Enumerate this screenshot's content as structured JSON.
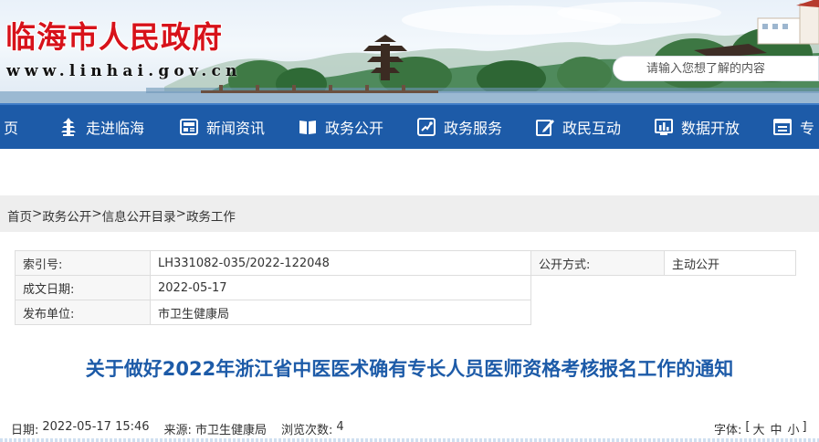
{
  "header": {
    "site_title": "临海市人民政府",
    "site_url": "www.linhai.gov.cn",
    "search_placeholder": "请输入您想了解的内容"
  },
  "nav": {
    "items": [
      {
        "label": "页",
        "icon": "home-icon"
      },
      {
        "label": "走进临海",
        "icon": "pagoda-icon"
      },
      {
        "label": "新闻资讯",
        "icon": "news-icon"
      },
      {
        "label": "政务公开",
        "icon": "book-icon"
      },
      {
        "label": "政务服务",
        "icon": "service-icon"
      },
      {
        "label": "政民互动",
        "icon": "edit-icon"
      },
      {
        "label": "数据开放",
        "icon": "chart-icon"
      },
      {
        "label": "专",
        "icon": "topic-icon"
      }
    ]
  },
  "breadcrumb": {
    "items": [
      "首页",
      "政务公开",
      "信息公开目录",
      "政务工作"
    ],
    "separator": ">"
  },
  "meta": {
    "index_label": "索引号:",
    "index_value": "LH331082-035/2022-122048",
    "disclosure_label": "公开方式:",
    "disclosure_value": "主动公开",
    "date_label": "成文日期:",
    "date_value": "2022-05-17",
    "publisher_label": "发布单位:",
    "publisher_value": "市卫生健康局"
  },
  "article": {
    "title": "关于做好2022年浙江省中医医术确有专长人员医师资格考核报名工作的通知",
    "date_label": "日期:",
    "date_value": "2022-05-17 15:46",
    "source_label": "来源:",
    "source_value": "市卫生健康局",
    "views_label": "浏览次数:",
    "views_value": "4",
    "font_size_label": "字体:",
    "font_bracket_open": "[",
    "font_large": "大",
    "font_medium": "中",
    "font_small": "小",
    "font_bracket_close": "]"
  },
  "colors": {
    "nav_bg": "#1d5ba8",
    "title_blue": "#1d5ba8",
    "site_title_red": "#d7121a"
  }
}
